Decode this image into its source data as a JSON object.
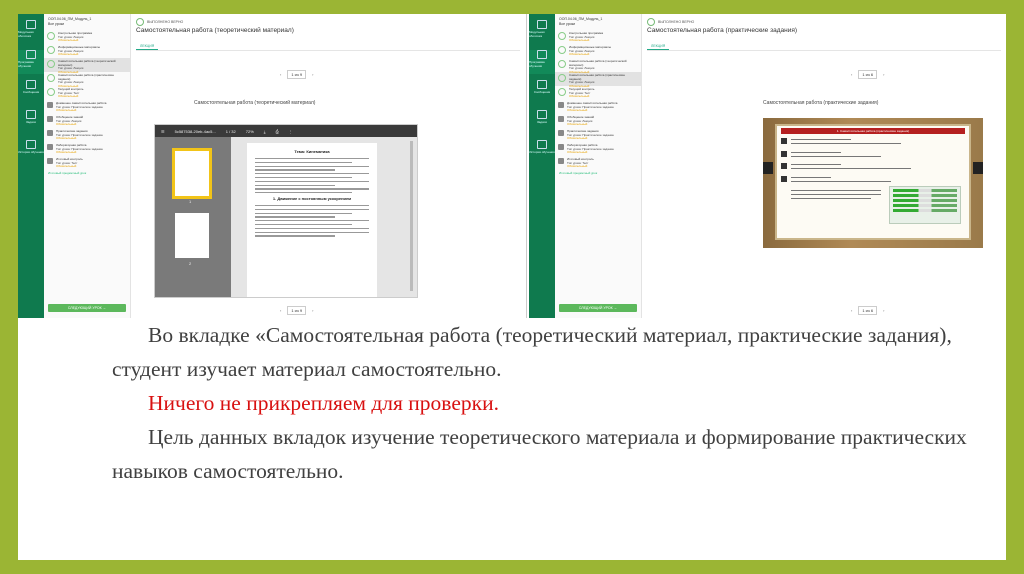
{
  "screenshot_left": {
    "nav_header": [
      "ООП.04.06_ПМ_Модуль_1",
      "Все уроки"
    ],
    "rail_items": [
      "Модульная оболочка",
      "Программа обучения",
      "Сообщения",
      "Задачи",
      "История обучения"
    ],
    "nav_items": [
      {
        "title": "Контрольная программа",
        "sub": "Тип урока: Лекция",
        "status": "Обязательный",
        "state": "done"
      },
      {
        "title": "Информационные материалы",
        "sub": "Тип урока: Лекция",
        "status": "Обязательный",
        "state": "done"
      },
      {
        "title": "Самостоятельная работа (теоретический материал)",
        "sub": "Тип урока: Лекция",
        "status": "Обязательный",
        "state": "selected"
      },
      {
        "title": "Самостоятельная работа (практические задания)",
        "sub": "Тип урока: Лекция",
        "status": "Обязательный",
        "state": "done"
      },
      {
        "title": "Текущий контроль",
        "sub": "Тип урока: Тест",
        "status": "Обязательный",
        "state": "done"
      },
      {
        "title": "Домашнее самостоятельная работа",
        "sub": "Тип урока: Практическое задание",
        "status": "Обязательный",
        "state": "locked"
      },
      {
        "title": "Обобщение знаний",
        "sub": "Тип урока: Лекция",
        "status": "Обязательный",
        "state": "locked"
      },
      {
        "title": "Практические задания",
        "sub": "Тип урока: Практическое задание",
        "status": "Обязательный",
        "state": "locked"
      },
      {
        "title": "Лабораторная работа",
        "sub": "Тип урока: Практическое задание",
        "status": "Обязательный",
        "state": "locked"
      },
      {
        "title": "Итоговый контроль",
        "sub": "Тип урока: Тест",
        "status": "Обязательный",
        "state": "locked"
      }
    ],
    "nav_link": "Итоговый предметный урок",
    "next_button": "СЛЕДУЮЩИЙ УРОК →",
    "status": "ВЫПОЛНЕНО ВЕРНО",
    "title": "Самостоятельная работа (теоретический материал)",
    "tab": "ЛЕКЦИЯ",
    "pager_value": "1 из 9",
    "content_title": "Самостоятельная работа (теоретический материал)",
    "viewer": {
      "filename": "5c587538-20eb-4ac5...",
      "page": "1 / 32",
      "zoom": "72%",
      "thumb_labels": [
        "1",
        "2"
      ],
      "page_heading": "Тема: Кинематика",
      "section_heading": "1. Движение с постоянным ускорением"
    }
  },
  "screenshot_right": {
    "nav_header": [
      "ООП.04.06_ПМ_Модуль_1",
      "Все уроки"
    ],
    "rail_items": [
      "Модульная оболочка",
      "Программа обучения",
      "Сообщения",
      "Задачи",
      "История обучения"
    ],
    "nav_items": [
      {
        "title": "Контрольная программа",
        "sub": "Тип урока: Лекция",
        "status": "Обязательный",
        "state": "done"
      },
      {
        "title": "Информационные материалы",
        "sub": "Тип урока: Лекция",
        "status": "Обязательный",
        "state": "done"
      },
      {
        "title": "Самостоятельная работа (теоретический материал)",
        "sub": "Тип урока: Лекция",
        "status": "Обязательный",
        "state": "done"
      },
      {
        "title": "Самостоятельная работа (практические задания)",
        "sub": "Тип урока: Лекция",
        "status": "Обязательный",
        "state": "selected"
      },
      {
        "title": "Текущий контроль",
        "sub": "Тип урока: Тест",
        "status": "Обязательный",
        "state": "done"
      },
      {
        "title": "Домашнее самостоятельная работа",
        "sub": "Тип урока: Практическое задание",
        "status": "Обязательный",
        "state": "locked"
      },
      {
        "title": "Обобщение знаний",
        "sub": "Тип урока: Лекция",
        "status": "Обязательный",
        "state": "locked"
      },
      {
        "title": "Практические задания",
        "sub": "Тип урока: Практическое задание",
        "status": "Обязательный",
        "state": "locked"
      },
      {
        "title": "Лабораторная работа",
        "sub": "Тип урока: Практическое задание",
        "status": "Обязательный",
        "state": "locked"
      },
      {
        "title": "Итоговый контроль",
        "sub": "Тип урока: Тест",
        "status": "Обязательный",
        "state": "locked"
      }
    ],
    "nav_link": "Итоговый предметный урок",
    "next_button": "СЛЕДУЮЩИЙ УРОК →",
    "status": "ВЫПОЛНЕНО ВЕРНО",
    "title": "Самостоятельная работа (практические задания)",
    "tab": "ЛЕКЦИЯ",
    "pager_value": "1 из 6",
    "content_title": "Самостоятельная работа (практические задания)",
    "image_header": "1. Самостоятельная работа (практические задания)"
  },
  "body_text": {
    "p1": "Во вкладке «Самостоятельная работа (теоретический материал, практические задания), студент изучает материал самостоятельно.",
    "p2": "Ничего не прикрепляем для проверки.",
    "p3": "Цель данных вкладок изучение теоретического материала и формирование практических навыков самостоятельно."
  },
  "colors": {
    "background": "#9bb534",
    "rail": "#0f7a4e",
    "accent": "#5cb85c",
    "highlight": "#d81010"
  }
}
